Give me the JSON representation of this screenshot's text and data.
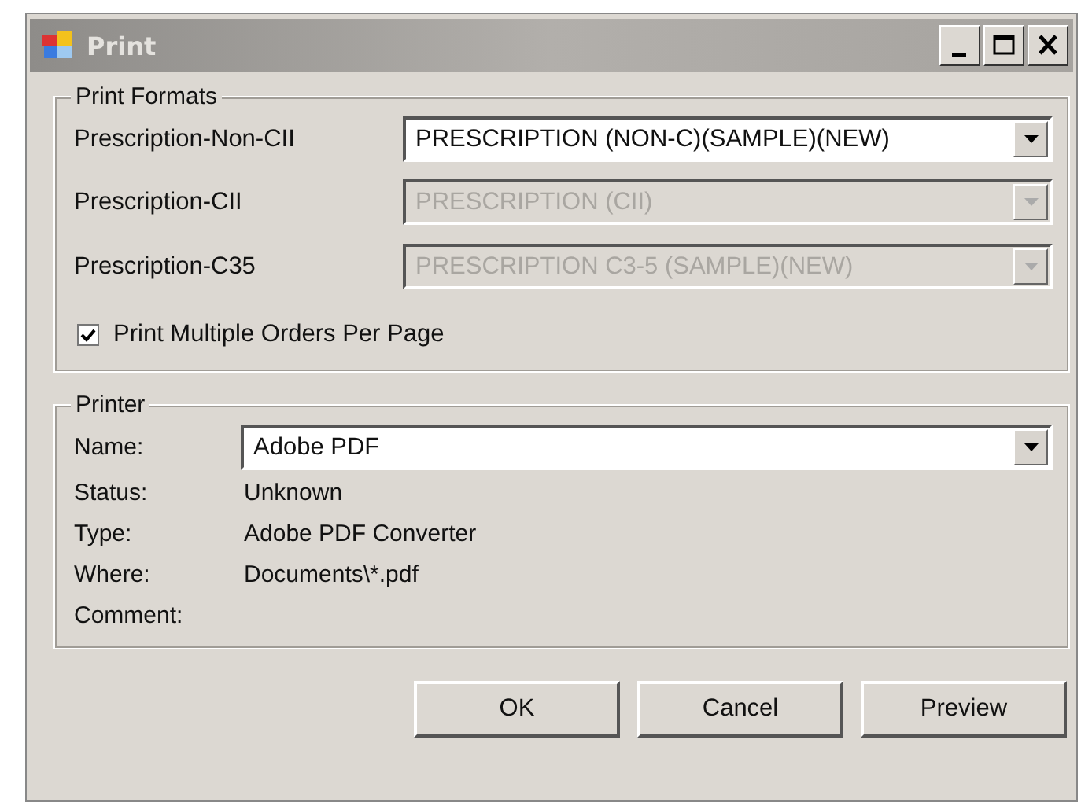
{
  "window": {
    "title": "Print"
  },
  "print_formats": {
    "title": "Print Formats",
    "rows": [
      {
        "label": "Prescription-Non-CII",
        "value": "PRESCRIPTION (NON-C)(SAMPLE)(NEW)",
        "disabled": false
      },
      {
        "label": "Prescription-CII",
        "value": "PRESCRIPTION (CII)",
        "disabled": true
      },
      {
        "label": "Prescription-C35",
        "value": "PRESCRIPTION C3-5 (SAMPLE)(NEW)",
        "disabled": true
      }
    ],
    "multiple_orders": {
      "label": "Print Multiple Orders Per Page",
      "checked": true
    }
  },
  "printer": {
    "title": "Printer",
    "name_label": "Name:",
    "name_value": "Adobe PDF",
    "info": [
      {
        "label": "Status:",
        "value": "Unknown"
      },
      {
        "label": "Type:",
        "value": "Adobe PDF Converter"
      },
      {
        "label": "Where:",
        "value": "Documents\\*.pdf"
      },
      {
        "label": "Comment:"
      }
    ]
  },
  "buttons": [
    "OK",
    "Cancel",
    "Preview"
  ]
}
